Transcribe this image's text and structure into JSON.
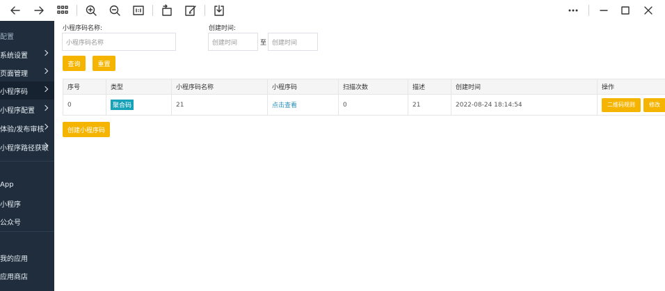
{
  "toolbar": {
    "icons": [
      "back-arrow-icon",
      "forward-arrow-icon",
      "grid-icon",
      "zoom-in-icon",
      "zoom-out-icon",
      "actual-size-icon",
      "rotate-icon",
      "edit-icon",
      "save-icon",
      "more-icon",
      "minimize-icon",
      "maximize-icon",
      "close-icon"
    ]
  },
  "sidebar": {
    "top_label": "配置",
    "items": [
      {
        "label": "系统设置"
      },
      {
        "label": "页面管理"
      },
      {
        "label": "小程序码"
      },
      {
        "label": "小程序配置"
      },
      {
        "label": "体验/发布审核"
      },
      {
        "label": "小程序路径获取"
      }
    ],
    "platforms": [
      "App",
      "小程序",
      "公众号"
    ],
    "apps": [
      "我的应用",
      "应用商店"
    ]
  },
  "filters": {
    "name_label": "小程序码名称:",
    "name_placeholder": "小程序码名称",
    "time_label": "创建时间:",
    "start_placeholder": "创建时间",
    "to_label": "至",
    "end_placeholder": "创建时间",
    "query_button": "查询",
    "reset_button": "重置"
  },
  "table": {
    "headers": [
      "序号",
      "类型",
      "小程序码名称",
      "小程序码",
      "扫描次数",
      "描述",
      "创建时间",
      "操作"
    ],
    "rows": [
      {
        "index": "0",
        "type": "聚合码",
        "name": "21",
        "code_link": "点击查看",
        "scans": "0",
        "desc": "21",
        "created": "2022-08-24 18:14:54",
        "op1": "二维码规则",
        "op2": "修改"
      }
    ]
  },
  "create_button": "创建小程序码",
  "colors": {
    "sidebar_bg": "#1f2d3d",
    "accent": "#f5b400",
    "tag": "#17a2b8",
    "link": "#2a8fbd"
  }
}
